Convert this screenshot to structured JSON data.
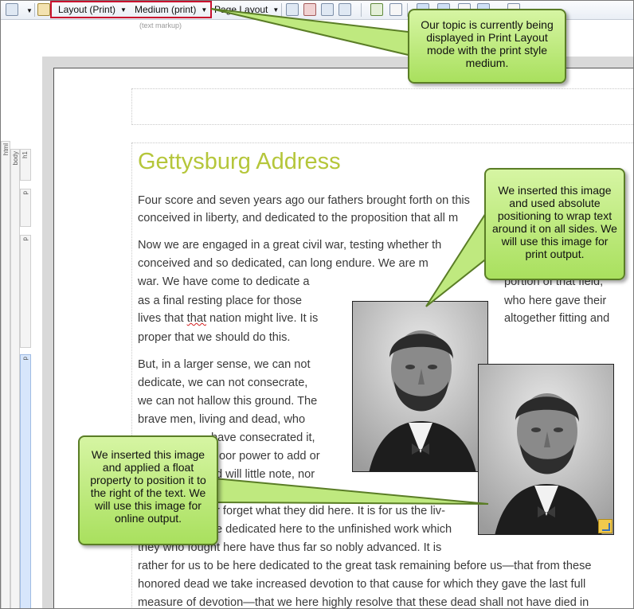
{
  "toolbar": {
    "layout_dropdown": "Layout (Print)",
    "medium_dropdown": "Medium (print)",
    "page_layout_dropdown": "Page Layout",
    "hint": "(text markup)"
  },
  "structure": {
    "html": "html",
    "body": "body",
    "h1": "h1",
    "p1": "p",
    "p2": "p",
    "p3": "p"
  },
  "article": {
    "title": "Gettysburg Address",
    "lines": [
      "Four score and seven years ago our fathers brought forth on this",
      "conceived in liberty, and dedicated to the proposition that all m",
      "Now we are engaged in a great civil war, testing whether th",
      "conceived and so dedicated, can long endure. We are m",
      "war. We have come to dedicate a",
      "portion of that field,",
      "as a final resting place for those",
      "who here gave their",
      "lives that ",
      "that",
      " nation might live. It is",
      "altogether fitting and",
      "proper that we should do this.",
      "But, in a larger sense, we can not",
      "dedicate, we can not consecrate,",
      "we can not hallow this ground. The",
      "brave men, living and dead, who",
      "have consecrated it,",
      "oor power to add or",
      "d will little note, nor",
      "r forget what they did here. It is for us the liv-",
      "e dedicated here to the unfinished work which",
      "they who fought here have thus far so nobly advanced. It is",
      "rather for us to be here dedicated to the great task remaining before us—that from these",
      "honored dead we take increased devotion to that cause for which they gave the last full",
      "measure of devotion—that we here highly resolve that these dead shall not have died in"
    ]
  },
  "callouts": {
    "print_mode": "Our topic is currently being displayed in Print Layout mode with the print style medium.",
    "absolute_image": "We inserted this image and used absolute positioning to wrap text around it on all sides. We will use this image for print output.",
    "float_image": "We inserted this image and applied a float property to position it to the right of the text. We will use this image for online output."
  },
  "icons": [
    "page-icon",
    "dropdown-arrow-icon",
    "wand-icon",
    "insert-image-icon",
    "insert-table-icon",
    "text-box-icon",
    "anchor-icon"
  ],
  "colors": {
    "title": "#b5c63a",
    "callout_fill": "#c3ec84",
    "callout_border": "#5a7d26",
    "highlight_box": "#c8102e"
  }
}
